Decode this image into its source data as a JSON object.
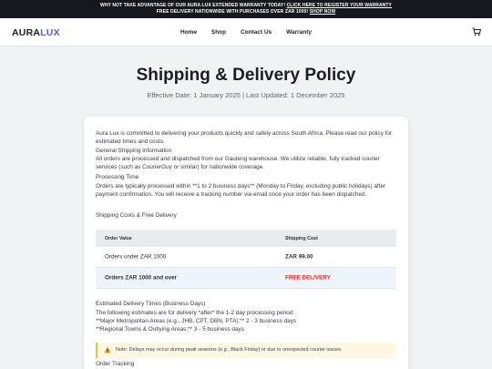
{
  "promo": {
    "line1": "WHY NOT TAKE ADVANTAGE OF OUR AURA LUX EXTENDED WARRANTY TODAY!",
    "line1_link": "CLICK HERE TO REGISTER YOUR WARRANTY",
    "line2": "FREE DELIVERY NATIONWIDE WITH PURCHASES OVER ZAR 1000!",
    "line2_link": "SHOP NOW"
  },
  "nav": {
    "logo_main": "AURA",
    "logo_accent": "LUX",
    "items": [
      "Home",
      "Shop",
      "Contact Us",
      "Warranty"
    ],
    "cart_icon": "cart-icon"
  },
  "page": {
    "title": "Shipping & Delivery Policy",
    "subtitle": "Effective Date: 1 January 2025 | Last Updated: 1 December 2025"
  },
  "content": {
    "intro": "Aura Lux is committed to delivering your products quickly and safely across South Africa. Please read our policy for estimated times and costs.",
    "general_heading": "General Shipping Information",
    "general_text": "All orders are processed and dispatched from our Gauteng warehouse. We utilize reliable, fully tracked courier services (such as CourierGuy or similar) for nationwide coverage.",
    "processing_heading": "Processing Time",
    "processing_text": "Orders are typically processed within **1 to 2 business days** (Monday to Friday, excluding public holidays) after payment confirmation. You will receive a tracking number via email once your order has been dispatched.",
    "costs_heading": "Shipping Costs & Free Delivery",
    "table": {
      "headers": [
        "Order Value",
        "Shipping Cost"
      ],
      "rows": [
        [
          "Orders under ZAR 1000",
          "ZAR 99.00"
        ],
        [
          "Orders ZAR 1000 and over",
          "FREE DELIVERY"
        ]
      ]
    },
    "estimated_heading": "Estimated Delivery Times (Business Days)",
    "estimated_text": "The following estimates are for delivery *after* the 1-2 day processing period:",
    "metro": "**Major Metropolitan Areas (e.g., JHB, CPT, DBN, PTA):** 2 - 3 business days",
    "regional": "**Regional Towns & Outlying Areas:** 3 - 5 business days",
    "note": "Note: Delays may occur during peak seasons (e.g., Black Friday) or due to unexpected courier issues.",
    "tracking_heading": "Order Tracking"
  },
  "colors": {
    "accent": "#5b5ce6",
    "promo_bg": "#17181d",
    "free_delivery": "#e02626",
    "note_bg": "#fdf8e4"
  }
}
